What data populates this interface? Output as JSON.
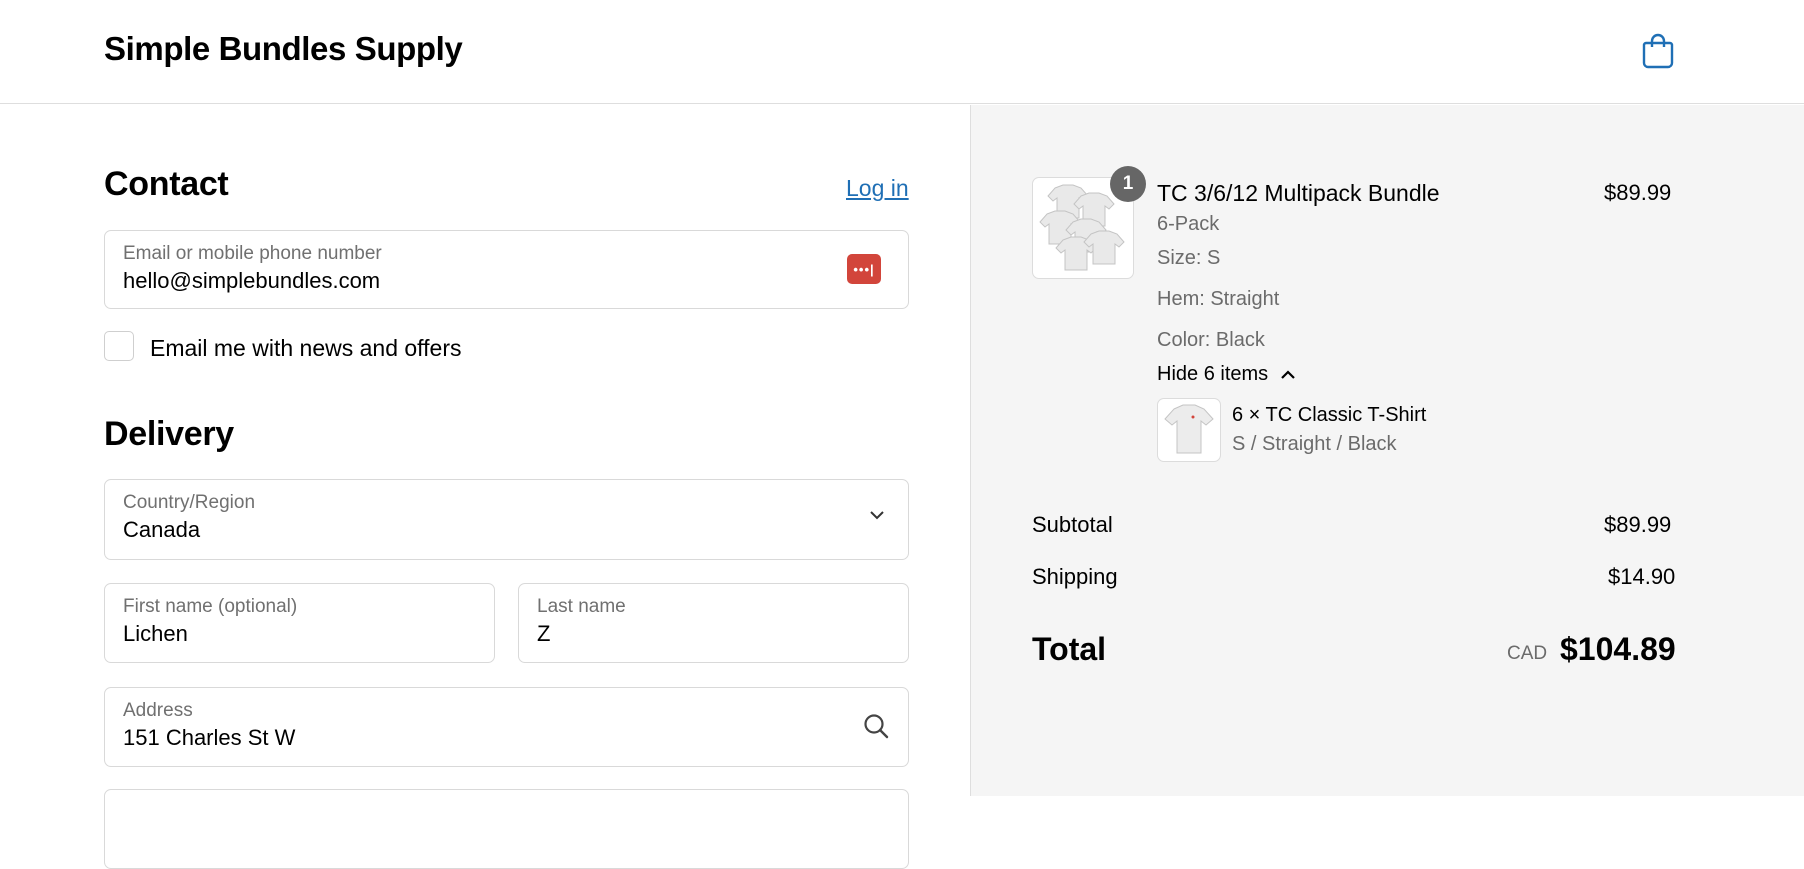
{
  "header": {
    "brand": "Simple Bundles Supply",
    "cart_icon": "shopping-bag-icon"
  },
  "contact": {
    "title": "Contact",
    "login_link": "Log in",
    "email_field": {
      "label": "Email or mobile phone number",
      "value": "hello@simplebundles.com",
      "password_manager_icon": "password-key-icon",
      "password_manager_glyph": "•••|"
    },
    "newsletter_checkbox": {
      "label": "Email me with news and offers",
      "checked": false
    }
  },
  "delivery": {
    "title": "Delivery",
    "country": {
      "label": "Country/Region",
      "value": "Canada"
    },
    "first_name": {
      "label": "First name (optional)",
      "value": "Lichen"
    },
    "last_name": {
      "label": "Last name",
      "value": "Z"
    },
    "address": {
      "label": "Address",
      "value": "151 Charles St W"
    }
  },
  "summary": {
    "item": {
      "quantity": "1",
      "name": "TC 3/6/12 Multipack Bundle",
      "variant": "6-Pack",
      "size": "Size: S",
      "hem": "Hem: Straight",
      "color": "Color: Black",
      "price": "$89.99",
      "toggle_label": "Hide 6 items",
      "sub_item": {
        "name": "6 × TC Classic T-Shirt",
        "options": "S / Straight / Black"
      }
    },
    "subtotal_label": "Subtotal",
    "subtotal_value": "$89.99",
    "shipping_label": "Shipping",
    "shipping_value": "$14.90",
    "total_label": "Total",
    "currency": "CAD",
    "total_value": "$104.89"
  },
  "colors": {
    "link": "#1f6fb5",
    "accent_icon": "#1f6fb5",
    "password_key": "#d2453b",
    "summary_bg": "#f5f5f5"
  }
}
